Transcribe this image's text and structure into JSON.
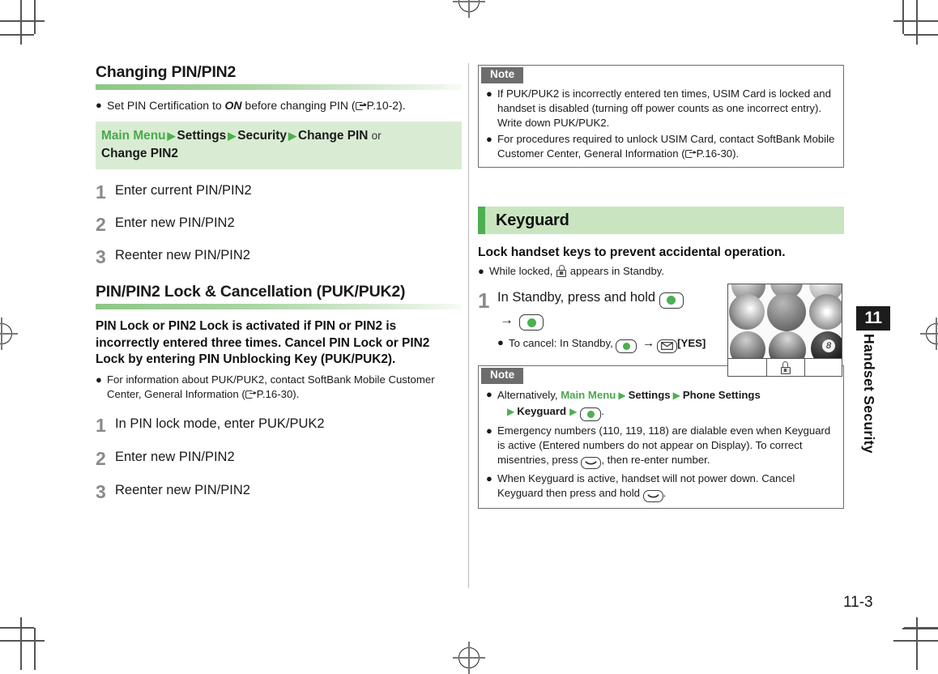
{
  "page": {
    "number": "11-3",
    "chapter_tab": "11",
    "chapter_label": "Handset Security"
  },
  "left_column": {
    "heading1": "Changing PIN/PIN2",
    "note_bullet": {
      "prefix": "Set PIN Certification to ",
      "emphasis": "ON",
      "suffix_before_ref": " before changing PIN (",
      "ref": "P.10-2",
      "suffix_after_ref": ")."
    },
    "path": {
      "main_menu": "Main Menu",
      "items": [
        "Settings",
        "Security",
        "Change PIN"
      ],
      "or_word": "or",
      "trailing": "Change PIN2",
      "arrow": "▶"
    },
    "steps1": [
      {
        "num": "1",
        "text": "Enter current PIN/PIN2"
      },
      {
        "num": "2",
        "text": "Enter new PIN/PIN2"
      },
      {
        "num": "3",
        "text": "Reenter new PIN/PIN2"
      }
    ],
    "heading2": "PIN/PIN2 Lock & Cancellation (PUK/PUK2)",
    "lead": "PIN Lock or PIN2 Lock is activated if PIN or PIN2 is incorrectly entered three times. Cancel PIN Lock or PIN2 Lock by entering PIN Unblocking Key (PUK/PUK2).",
    "lead_bullet": {
      "before_ref": "For information about PUK/PUK2, contact SoftBank Mobile Customer Center, General Information (",
      "ref": "P.16-30",
      "after_ref": ")."
    },
    "steps2": [
      {
        "num": "1",
        "text": "In PIN lock mode, enter PUK/PUK2"
      },
      {
        "num": "2",
        "text": "Enter new PIN/PIN2"
      },
      {
        "num": "3",
        "text": "Reenter new PIN/PIN2"
      }
    ]
  },
  "right_column": {
    "note_top": {
      "tab_label": "Note",
      "bullets": [
        {
          "text": "If PUK/PUK2 is incorrectly entered ten times, USIM Card is locked and handset is disabled (turning off power counts as one incorrect entry). Write down PUK/PUK2."
        },
        {
          "before_ref": "For procedures required to unlock USIM Card, contact SoftBank Mobile Customer Center, General Information (",
          "ref": "P.16-30",
          "after_ref": ")."
        }
      ]
    },
    "section": {
      "title": "Keyguard",
      "lead": "Lock handset keys to prevent accidental operation.",
      "lead_bullet_before_icon": "While locked, ",
      "lead_bullet_after_icon": " appears in Standby."
    },
    "step": {
      "num": "1",
      "line1": "In Standby, press and hold",
      "line2_arrow": "→",
      "cancel_prefix": "To cancel: In Standby,",
      "cancel_arrow": "→",
      "cancel_yes": "[YES]"
    },
    "note_bottom": {
      "tab_label": "Note",
      "bullet1": {
        "prefix": "Alternatively, ",
        "main_menu": "Main Menu",
        "items": [
          "Settings",
          "Phone Settings",
          "Keyguard"
        ],
        "arrow": "▶",
        "suffix": "."
      },
      "bullet2": {
        "part1": "Emergency numbers (110, 119, 118) are dialable even when Keyguard is active (Entered numbers do not appear on Display). To correct misentries, press",
        "part2": ", then re-enter number."
      },
      "bullet3": {
        "part1": "When Keyguard is active, handset will not power down. Cancel Keyguard then press and hold",
        "part2": "."
      }
    },
    "screenshot": {
      "alt": "Standby screen with wallpaper and Keyguard lock indicator",
      "softkey_center_icon": "padlock-icon"
    }
  },
  "colors": {
    "accent_green": "#4cb050",
    "menu_green": "#49a94c",
    "path_bg": "#d9ecd3",
    "section_bg": "#c9e5c0",
    "note_border": "#6d6d6d",
    "step_number": "#8a8a8a"
  }
}
